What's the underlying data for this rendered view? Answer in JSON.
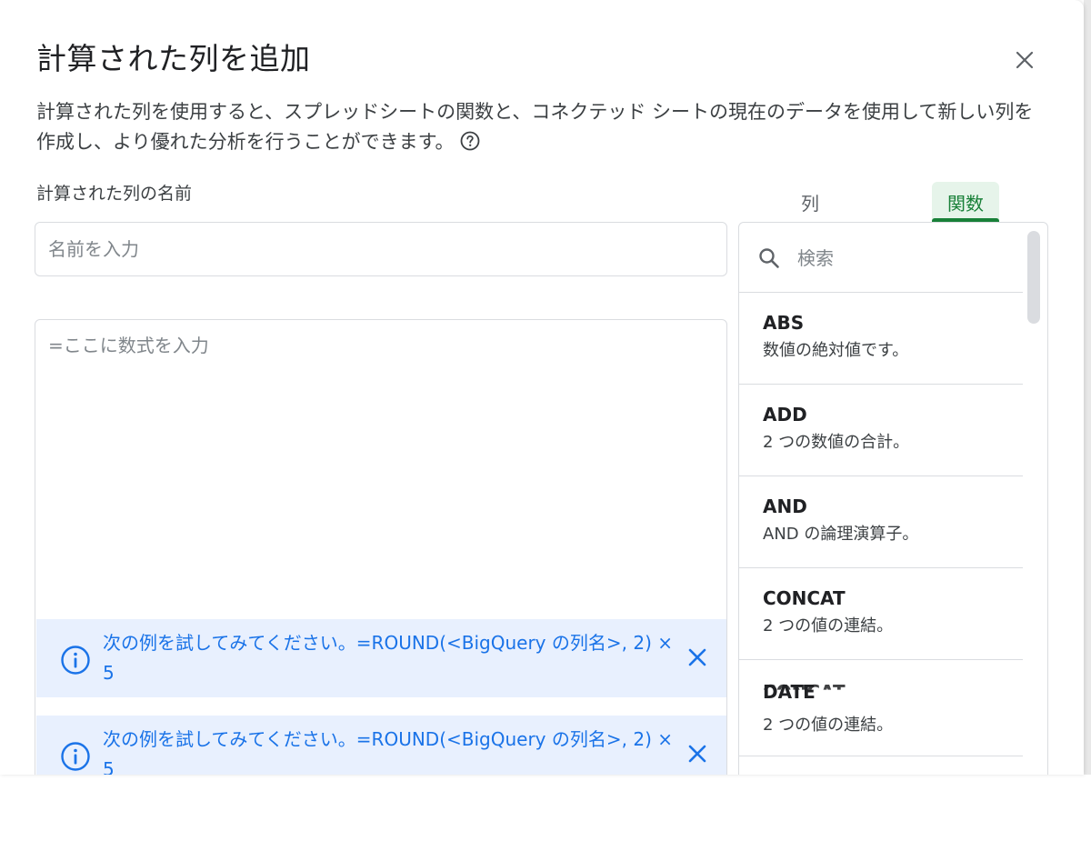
{
  "dialog": {
    "title": "計算された列を追加",
    "description": "計算された列を使用すると、スプレッドシートの関数と、コネクテッド シートの現在のデータを使用して新しい列を作成し、より優れた分析を行うことができます。"
  },
  "name_field": {
    "label": "計算された列の名前",
    "placeholder": "名前を入力",
    "value": ""
  },
  "formula": {
    "placeholder": "=ここに数式を入力",
    "value": ""
  },
  "hints": [
    {
      "text": "次の例を試してみてください。=ROUND(<BigQuery の列名>, 2) × 5"
    },
    {
      "text": "次の例を試してみてください。=ROUND(<BigQuery の列名>, 2) × 5"
    }
  ],
  "tabs": {
    "columns_label": "列",
    "functions_label": "関数",
    "selected": "関数"
  },
  "functions_panel": {
    "search_placeholder": "検索",
    "items": [
      {
        "name": "ABS",
        "description": "数値の絶対値です。"
      },
      {
        "name": "ADD",
        "description": "2 つの数値の合計。"
      },
      {
        "name": "AND",
        "description": "AND の論理演算子。"
      },
      {
        "name": "CONCAT",
        "description": "2 つの値の連結。"
      },
      {
        "name": "DATE",
        "ghost_name": "CONCAT",
        "description": "2 つの値の連結。"
      }
    ]
  },
  "colors": {
    "accent_blue": "#1a73e8",
    "hint_background": "#e8f0fe",
    "tab_active_green": "#188038",
    "tab_active_background": "#e6f4ea"
  },
  "icons": {
    "close": "close-icon",
    "help": "help-icon",
    "search": "search-icon",
    "info": "info-icon"
  }
}
